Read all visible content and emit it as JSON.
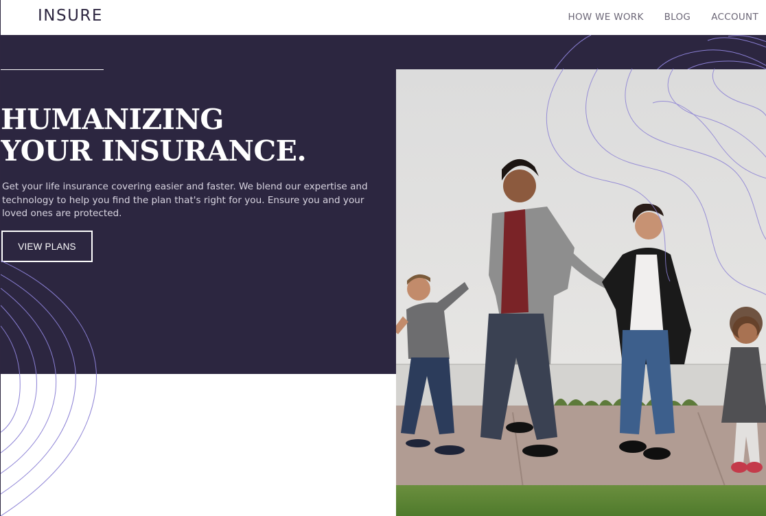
{
  "header": {
    "logo": "INSURE",
    "nav": [
      {
        "label": "HOW WE WORK"
      },
      {
        "label": "BLOG"
      },
      {
        "label": "ACCOUNT"
      }
    ]
  },
  "hero": {
    "headline_line1": "HUMANIZING",
    "headline_line2": "YOUR INSURANCE.",
    "intro": "Get your life insurance covering easier and faster. We blend our expertise and technology to help you find the plan that's right for you. Ensure you and your loved ones are protected.",
    "cta_label": "VIEW PLANS"
  },
  "colors": {
    "dark_violet": "#2c2640",
    "pattern_line": "#8a7fd4",
    "white": "#ffffff"
  }
}
